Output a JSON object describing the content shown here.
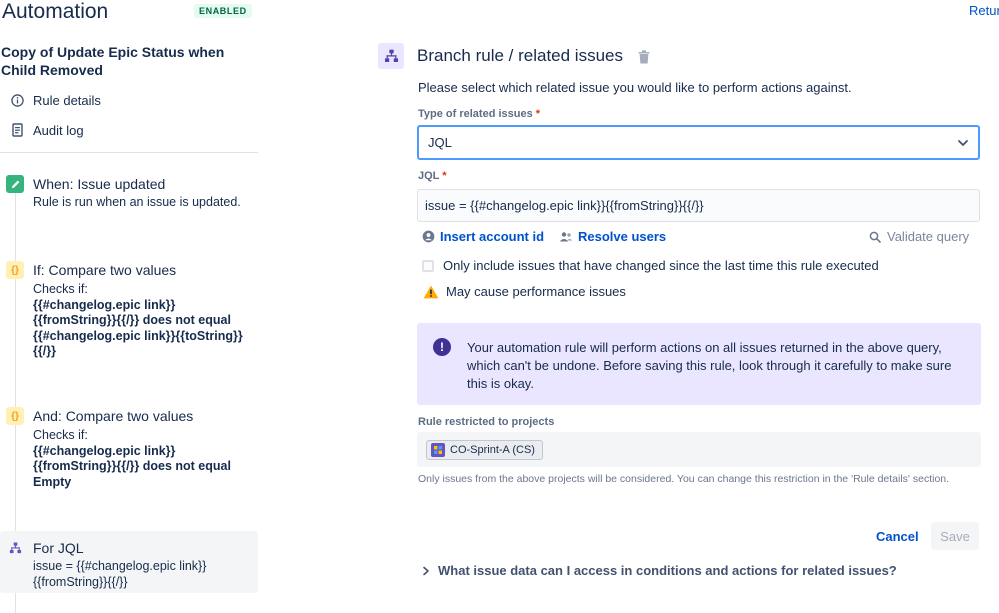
{
  "header": {
    "title": "Automation",
    "status_badge": "ENABLED",
    "return_link": "Retur"
  },
  "sidebar": {
    "rule_name": "Copy of Update Epic Status when Child Removed",
    "links": [
      {
        "label": "Rule details",
        "icon": "info-icon"
      },
      {
        "label": "Audit log",
        "icon": "document-icon"
      }
    ],
    "steps": [
      {
        "title": "When: Issue updated",
        "desc": "Rule is run when an issue is updated.",
        "icon": "pencil-icon"
      },
      {
        "title": "If: Compare two values",
        "desc_prefix": "Checks if:",
        "desc_bold": "{{#changelog.epic link}}{{fromString}}{{/}} does not equal {{#changelog.epic link}}{{toString}}{{/}}",
        "icon": "braces-icon"
      },
      {
        "title": "And: Compare two values",
        "desc_prefix": "Checks if:",
        "desc_bold": "{{#changelog.epic link}}{{fromString}}{{/}} does not equal Empty",
        "icon": "braces-icon"
      },
      {
        "title": "For JQL",
        "desc": "issue = {{#changelog.epic link}}{{fromString}}{{/}}",
        "icon": "branch-icon"
      }
    ]
  },
  "main": {
    "title": "Branch rule / related issues",
    "instruction": "Please select which related issue you would like to perform actions against.",
    "type_label": "Type of related issues",
    "type_value": "JQL",
    "jql_label": "JQL",
    "jql_value": "issue = {{#changelog.epic link}}{{fromString}}{{/}}",
    "insert_account_id": "Insert account id",
    "resolve_users": "Resolve users",
    "validate_query": "Validate query",
    "checkbox_label": "Only include issues that have changed since the last time this rule executed",
    "warning": "May cause performance issues",
    "info_message": "Your automation rule will perform actions on all issues returned in the above query, which can't be undone. Before saving this rule, look through it carefully to make sure this is okay.",
    "restricted_label": "Rule restricted to projects",
    "project_chip": "CO-Sprint-A (CS)",
    "helper_text": "Only issues from the above projects will be considered. You can change this restriction in the 'Rule details' section.",
    "cancel": "Cancel",
    "save": "Save",
    "accordion": "What issue data can I access in conditions and actions for related issues?"
  },
  "colors": {
    "primary": "#0052CC",
    "enabled_bg": "#E3FCEF",
    "enabled_text": "#006644",
    "info_bg": "#EAE6FF",
    "warning": "#FFAB00",
    "focus_border": "#4C9AFF"
  }
}
